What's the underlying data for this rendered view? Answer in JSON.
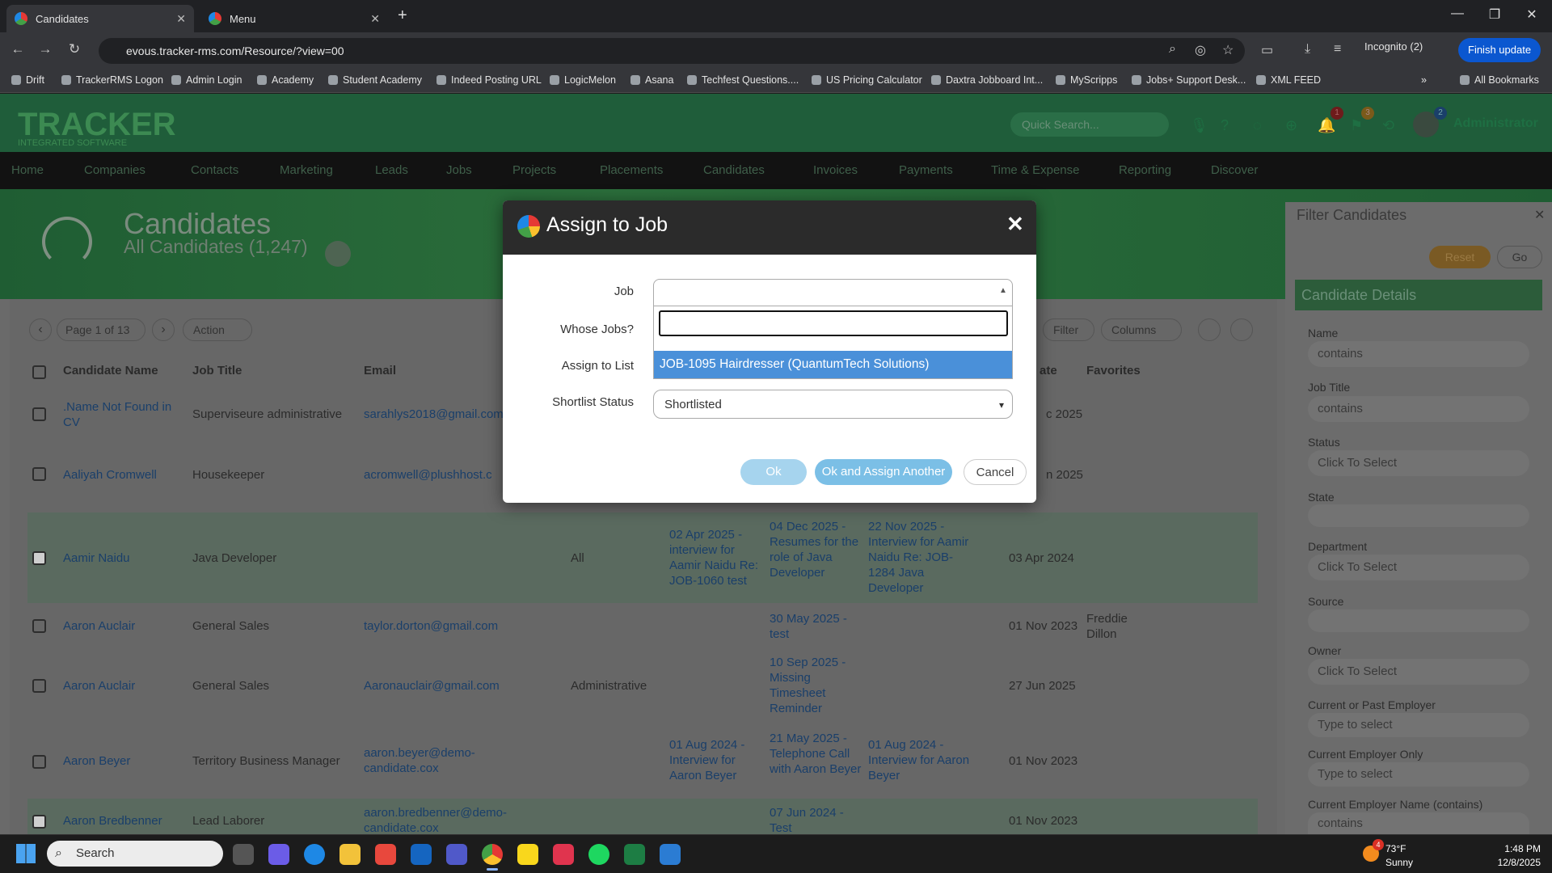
{
  "browser": {
    "tabs": [
      {
        "label": "Candidates"
      },
      {
        "label": "Menu"
      }
    ],
    "url": "evous.tracker-rms.com/Resource/?view=00",
    "incognito_label": "Incognito (2)",
    "finish_update_label": "Finish update",
    "bookmarks": [
      "Drift",
      "TrackerRMS Logon",
      "Admin Login",
      "Academy",
      "Student Academy",
      "Indeed Posting URL",
      "LogicMelon",
      "Asana",
      "Techfest Questions....",
      "US Pricing Calculator",
      "Daxtra Jobboard Int...",
      "MyScripps",
      "Jobs+ Support Desk...",
      "XML FEED"
    ],
    "all_bookmarks_label": "All Bookmarks"
  },
  "app": {
    "logo_text": "TRACKER",
    "logo_sub": "INTEGRATED SOFTWARE",
    "quick_search_placeholder": "Quick Search...",
    "badges": {
      "alerts": "1",
      "flags": "3",
      "user": "2"
    },
    "user_name": "Administrator",
    "nav": [
      "Home",
      "Companies",
      "Contacts",
      "Marketing",
      "Leads",
      "Jobs",
      "Projects",
      "Placements",
      "Candidates",
      "Invoices",
      "Payments",
      "Time & Expense",
      "Reporting",
      "Discover"
    ]
  },
  "page": {
    "title": "Candidates",
    "subtitle": "All Candidates (1,247)",
    "pager_label": "Page 1 of 13",
    "action_label": "Action",
    "filter_label": "Filter",
    "columns_label": "Columns",
    "table_headers": [
      "Candidate Name",
      "Job Title",
      "Email",
      "ate",
      "Favorites"
    ],
    "rows": [
      {
        "name": ".Name Not Found in CV",
        "title": "Superviseure administrative",
        "email": "sarahlys2018@gmail.com",
        "c4": "",
        "c5": "",
        "c6": "",
        "c7": "",
        "date": "c 2025",
        "fav": "",
        "checked": false
      },
      {
        "name": "Aaliyah Cromwell",
        "title": "Housekeeper",
        "email": "acromwell@plushhost.c",
        "c4": "",
        "c5": "",
        "c6": "",
        "c7": "",
        "date": "n 2025",
        "fav": "",
        "checked": false
      },
      {
        "name": "Aamir Naidu",
        "title": "Java Developer",
        "email": "",
        "c4": "All",
        "c5": "02 Apr 2025 - interview for Aamir Naidu Re: JOB-1060 test",
        "c6": "04 Dec 2025 - Resumes for the role of Java Developer",
        "c7": "22 Nov 2025 - Interview for Aamir Naidu Re: JOB-1284 Java Developer",
        "date": "03 Apr 2024",
        "fav": "",
        "checked": true
      },
      {
        "name": "Aaron Auclair",
        "title": "General Sales",
        "email": "taylor.dorton@gmail.com",
        "c4": "",
        "c5": "",
        "c6": "30 May 2025 - test",
        "c7": "",
        "date": "01 Nov 2023",
        "fav": "Freddie Dillon",
        "checked": false
      },
      {
        "name": "Aaron Auclair",
        "title": "General Sales",
        "email": "Aaronauclair@gmail.com",
        "c4": "Administrative",
        "c5": "",
        "c6": "10 Sep 2025 - Missing Timesheet Reminder",
        "c7": "",
        "date": "27 Jun 2025",
        "fav": "",
        "checked": false
      },
      {
        "name": "Aaron Beyer",
        "title": "Territory Business Manager",
        "email": "aaron.beyer@demo-candidate.cox",
        "c4": "",
        "c5": "01 Aug 2024 - Interview for Aaron Beyer",
        "c6": "21 May 2025 - Telephone Call with Aaron Beyer",
        "c7": "01 Aug 2024 - Interview for Aaron Beyer",
        "date": "01 Nov 2023",
        "fav": "",
        "checked": false
      },
      {
        "name": "Aaron Bredbenner",
        "title": "Lead Laborer",
        "email": "aaron.bredbenner@demo-candidate.cox",
        "c4": "",
        "c5": "",
        "c6": "07 Jun 2024 - Test",
        "c7": "",
        "date": "01 Nov 2023",
        "fav": "",
        "checked": true
      }
    ]
  },
  "filter_panel": {
    "title": "Filter Candidates",
    "reset_label": "Reset",
    "go_label": "Go",
    "section_title": "Candidate Details",
    "fields": [
      {
        "label": "Name",
        "value": "contains"
      },
      {
        "label": "Job Title",
        "value": "contains"
      },
      {
        "label": "Status",
        "value": "Click To Select"
      },
      {
        "label": "State",
        "value": ""
      },
      {
        "label": "Department",
        "value": "Click To Select"
      },
      {
        "label": "Source",
        "value": ""
      },
      {
        "label": "Owner",
        "value": "Click To Select"
      },
      {
        "label": "Current or Past Employer",
        "value": "Type to select"
      },
      {
        "label": "Current Employer Only",
        "value": "Type to select"
      },
      {
        "label": "Current Employer Name (contains)",
        "value": "contains"
      }
    ]
  },
  "modal": {
    "title": "Assign to Job",
    "labels": {
      "job": "Job",
      "whose_jobs": "Whose Jobs?",
      "assign_list": "Assign to List",
      "shortlist_status": "Shortlist Status"
    },
    "job_value": "",
    "dropdown_search_value": "",
    "dropdown_option": "JOB-1095 Hairdresser (QuantumTech Solutions)",
    "shortlist_value": "Shortlisted",
    "buttons": {
      "ok": "Ok",
      "ok_assign": "Ok and Assign Another",
      "cancel": "Cancel"
    }
  },
  "taskbar": {
    "search_placeholder": "Search",
    "weather_temp": "73°F",
    "weather_desc": "Sunny",
    "weather_badge": "4",
    "time": "1:48 PM",
    "date": "12/8/2025"
  }
}
